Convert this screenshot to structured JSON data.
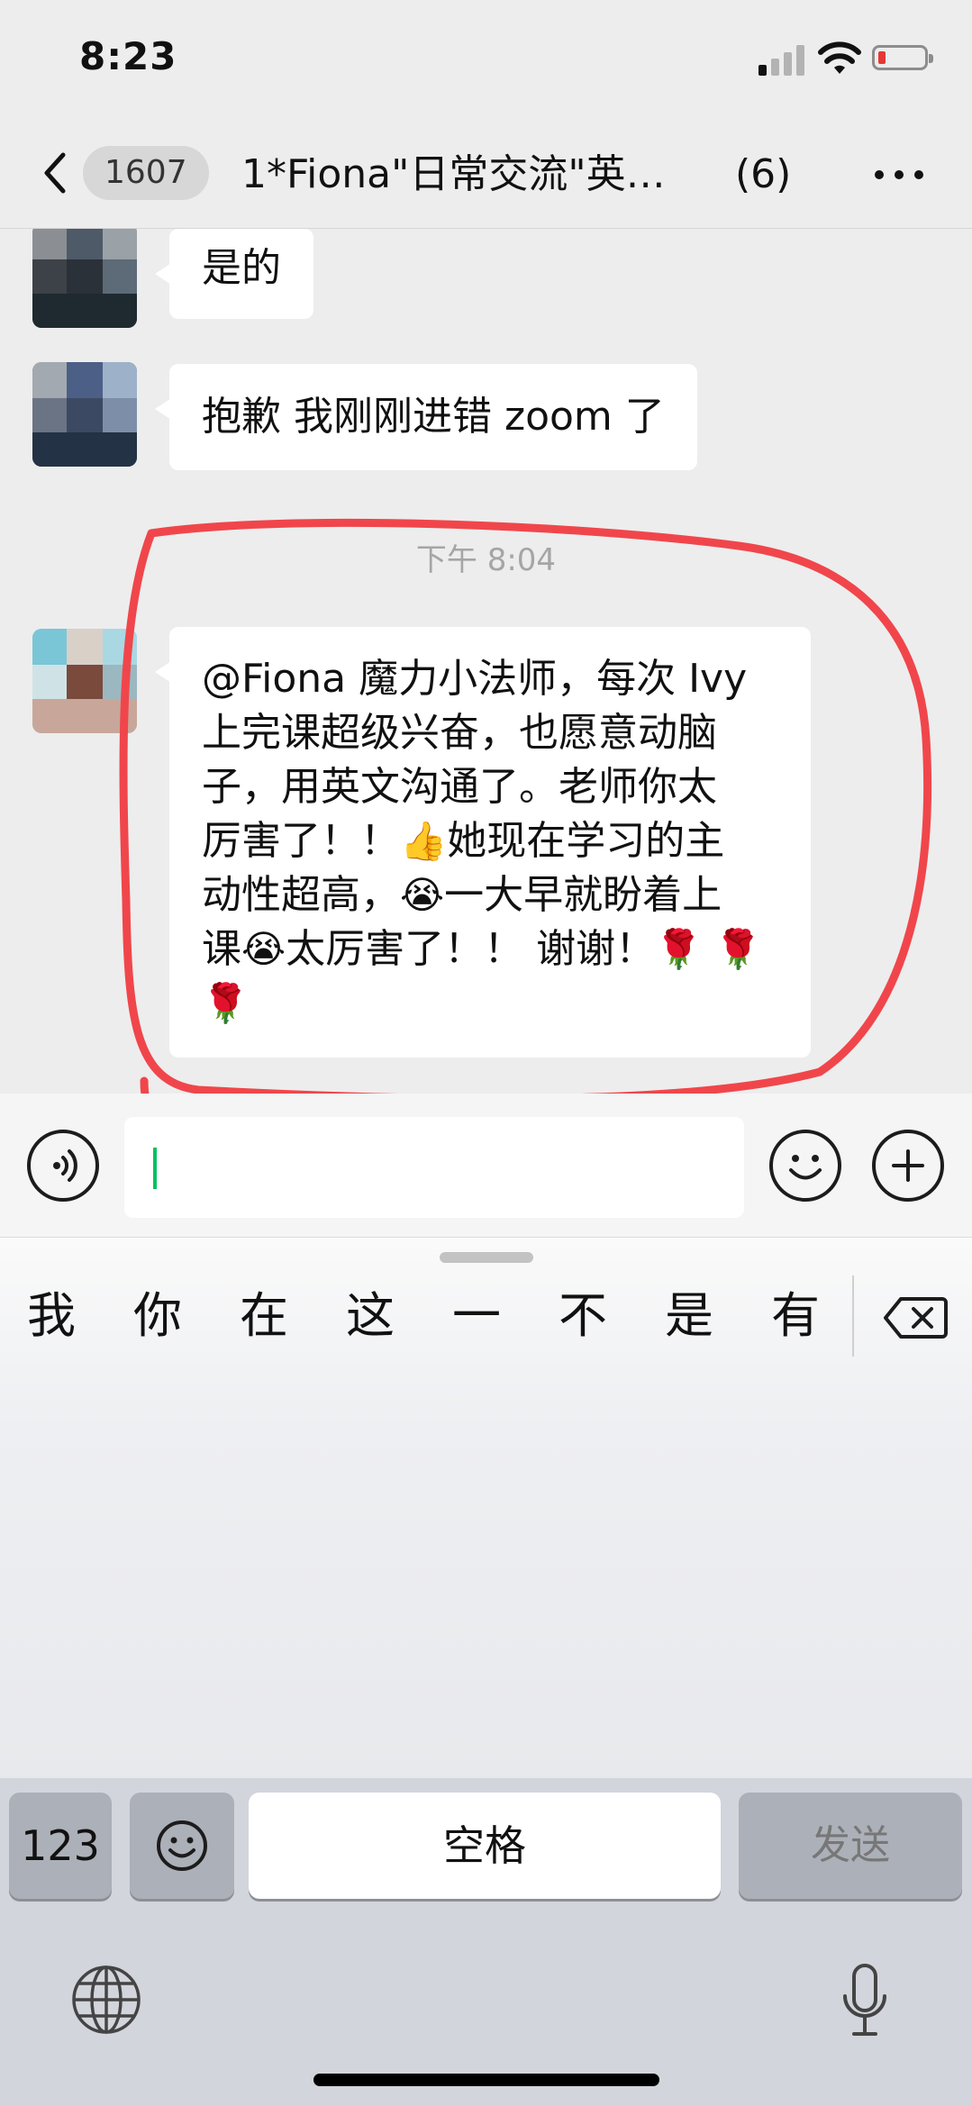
{
  "status_bar": {
    "time": "8:23",
    "signal_bars": 4,
    "signal_bars_on": 1,
    "battery_level": 0.1,
    "battery_color": "#e53935"
  },
  "nav": {
    "back_icon": "chevron-left-icon",
    "unread_count": "1607",
    "title": "1*Fiona\"日常交流\"英…",
    "member_count": "(6)",
    "more_icon": "ellipsis-icon"
  },
  "messages": [
    {
      "text": "是的"
    },
    {
      "text": "抱歉 我刚刚进错 zoom 了"
    },
    {
      "timestamp": "下午 8:04"
    },
    {
      "lines": [
        [
          "@Fiona 魔力小法师，每次 Ivy"
        ],
        [
          "上完课超级兴奋，也愿意动脑"
        ],
        [
          "子，用英文沟通了。老师你太"
        ],
        [
          "厉害了！！",
          "👍",
          "她现在学习的主"
        ],
        [
          "动性超高，",
          "😭",
          "一大早就盼着上"
        ],
        [
          "课",
          "😭",
          "太厉害了！！ 谢谢！",
          "🌹",
          " ",
          "🌹"
        ],
        [
          "🌹"
        ]
      ]
    }
  ],
  "annotation_color": "#f0464b",
  "input_bar": {
    "voice_icon": "voice-icon",
    "emoji_icon": "smiley-icon",
    "plus_icon": "plus-icon",
    "caret_color": "#07c160"
  },
  "keyboard": {
    "candidates": [
      "我",
      "你",
      "在",
      "这",
      "一",
      "不",
      "是",
      "有"
    ],
    "delete_icon": "backspace-icon",
    "keys": {
      "numbers": "123",
      "emoji_icon": "smiley-icon",
      "space": "空格",
      "send": "发送"
    },
    "globe_icon": "globe-icon",
    "mic_icon": "microphone-icon"
  }
}
